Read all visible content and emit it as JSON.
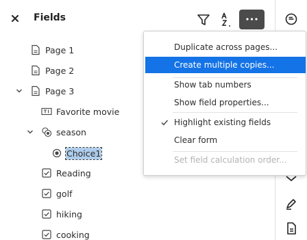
{
  "header": {
    "title": "Fields",
    "close_icon": "close-icon",
    "filter_icon": "filter-icon",
    "sort_icon": "sort-az-icon",
    "more_icon": "more-horizontal-icon"
  },
  "tree": [
    {
      "label": "Page 1",
      "icon": "page-icon"
    },
    {
      "label": "Page 2",
      "icon": "page-icon"
    },
    {
      "label": "Page 3",
      "icon": "page-icon",
      "expanded": true
    },
    {
      "label": "Favorite movie",
      "icon": "text-field-icon"
    },
    {
      "label": "season",
      "icon": "radio-group-icon",
      "expanded": true
    },
    {
      "label": "Choice1",
      "icon": "radio-button-icon",
      "selected": true
    },
    {
      "label": "Reading",
      "icon": "checkbox-icon"
    },
    {
      "label": "golf",
      "icon": "checkbox-icon"
    },
    {
      "label": "hiking",
      "icon": "checkbox-icon"
    },
    {
      "label": "cooking",
      "icon": "checkbox-icon"
    }
  ],
  "menu": {
    "items": [
      {
        "label": "Duplicate across pages..."
      },
      {
        "label": "Create multiple copies...",
        "highlighted": true
      },
      {
        "label": "Show tab numbers"
      },
      {
        "label": "Show field properties..."
      },
      {
        "label": "Highlight existing fields",
        "checked": true
      },
      {
        "label": "Clear form"
      },
      {
        "label": "Set field calculation order...",
        "disabled": true
      }
    ]
  },
  "colors": {
    "accent": "#1473e6",
    "selection": "#aecdeb",
    "more_button_bg": "#4b4b4b"
  }
}
